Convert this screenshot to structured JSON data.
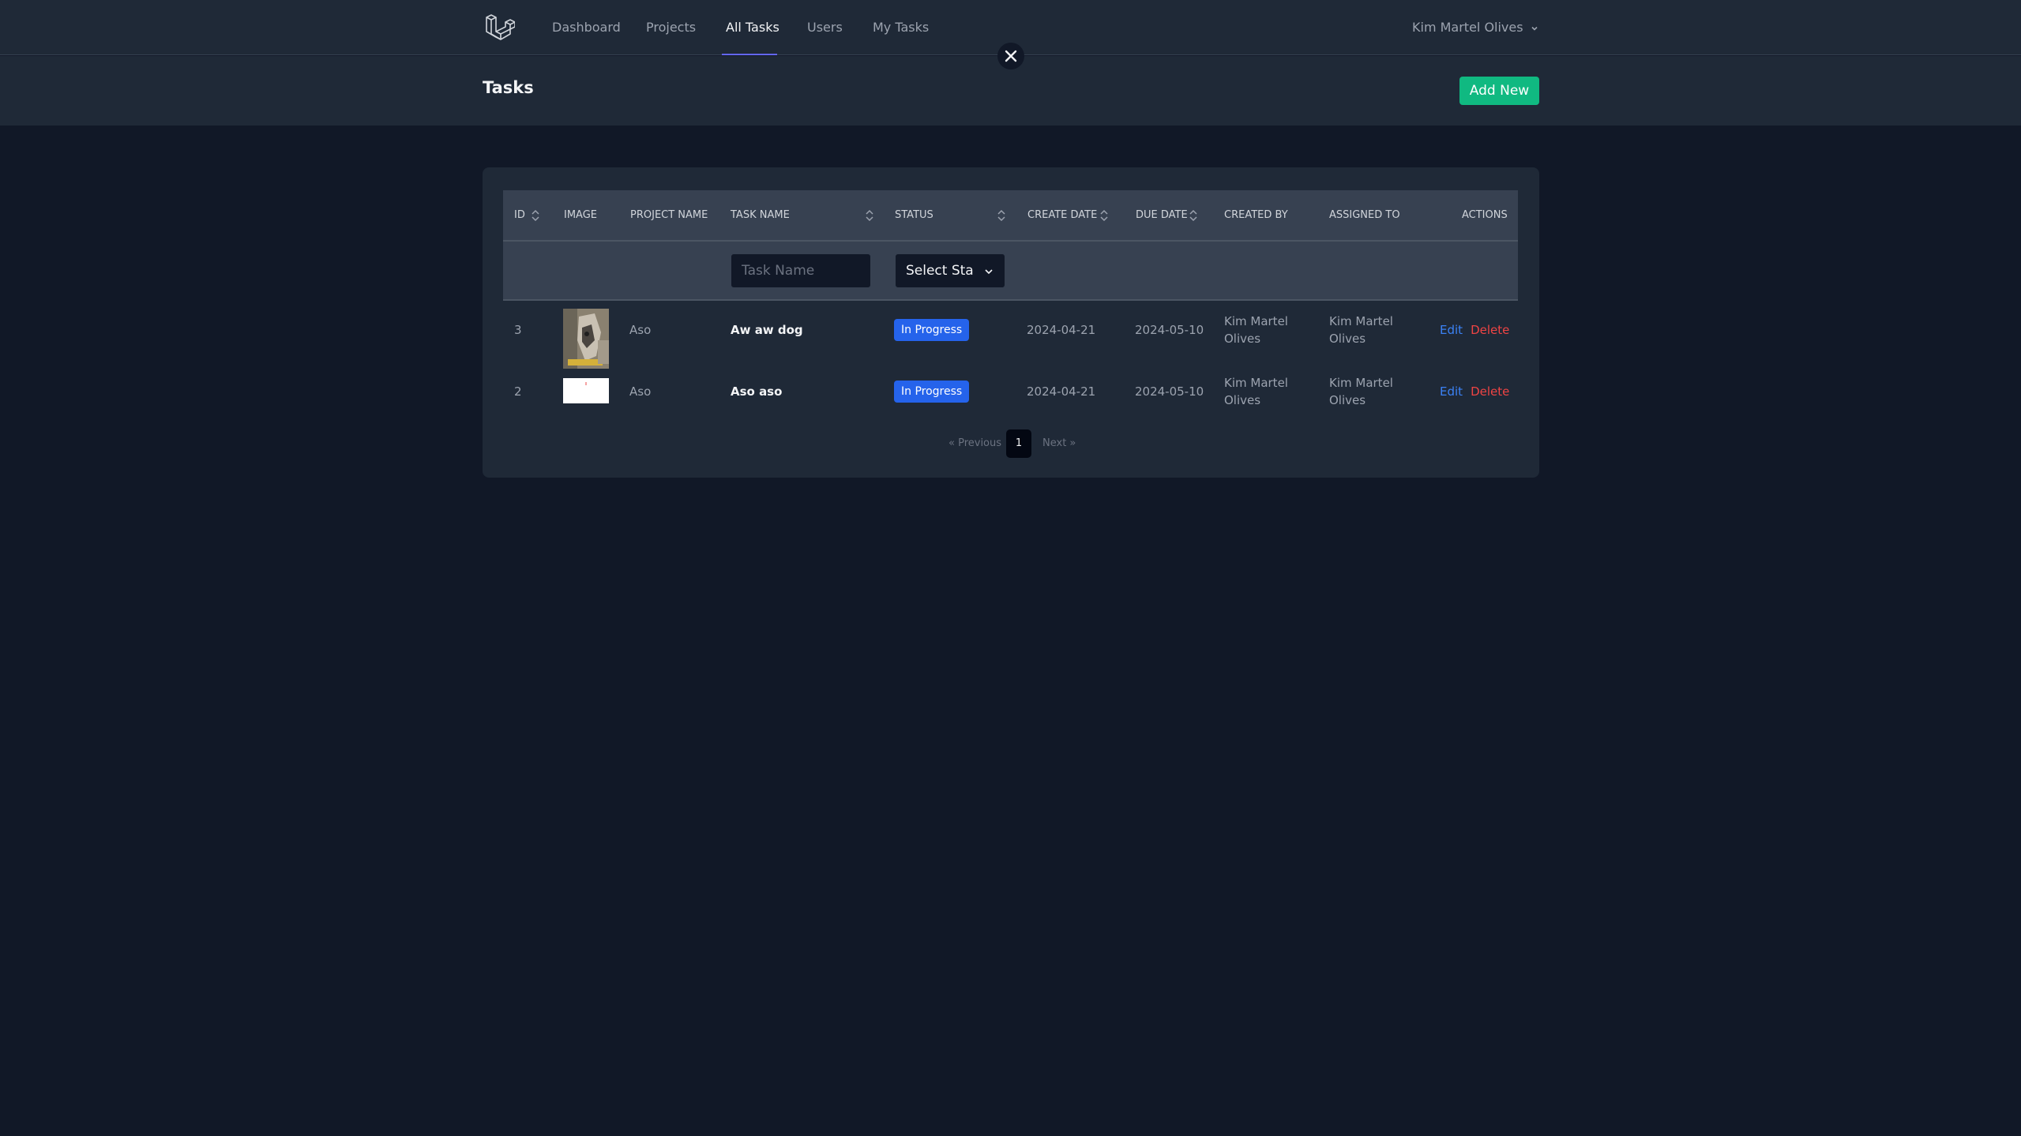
{
  "nav": {
    "links": [
      {
        "label": "Dashboard"
      },
      {
        "label": "Projects"
      },
      {
        "label": "All Tasks"
      },
      {
        "label": "Users"
      },
      {
        "label": "My Tasks"
      }
    ],
    "active": "All Tasks",
    "user_name": "Kim Martel Olives"
  },
  "header": {
    "title": "Tasks",
    "add_new_label": "Add New"
  },
  "table": {
    "columns": [
      "ID",
      "IMAGE",
      "PROJECT NAME",
      "TASK NAME",
      "STATUS",
      "CREATE DATE",
      "DUE DATE",
      "CREATED BY",
      "ASSIGNED TO",
      "ACTIONS"
    ],
    "filters": {
      "task_name_placeholder": "Task Name",
      "status_selected": "Select Status"
    },
    "rows": [
      {
        "id": "3",
        "project": "Aso",
        "name": "Aw aw dog",
        "status": "In Progress",
        "create_date": "2024-04-21",
        "due_date": "2024-05-10",
        "created_by": "Kim Martel Olives",
        "assigned_to": "Kim Martel Olives",
        "edit": "Edit",
        "delete": "Delete"
      },
      {
        "id": "2",
        "project": "Aso",
        "name": "Aso aso",
        "status": "In Progress",
        "create_date": "2024-04-21",
        "due_date": "2024-05-10",
        "created_by": "Kim Martel Olives",
        "assigned_to": "Kim Martel Olives",
        "edit": "Edit",
        "delete": "Delete"
      }
    ]
  },
  "pagination": {
    "previous": "« Previous",
    "current": "1",
    "next": "Next »"
  },
  "colors": {
    "background": "#111827",
    "panel": "#1f2937",
    "accent": "#6366f1",
    "add_button": "#10b981",
    "status_badge": "#2563eb",
    "edit_link": "#3b82f6",
    "delete_link": "#ef4444"
  },
  "icons": [
    "laravel-logo-icon",
    "chevron-down-icon",
    "close-icon",
    "sort-icon"
  ]
}
